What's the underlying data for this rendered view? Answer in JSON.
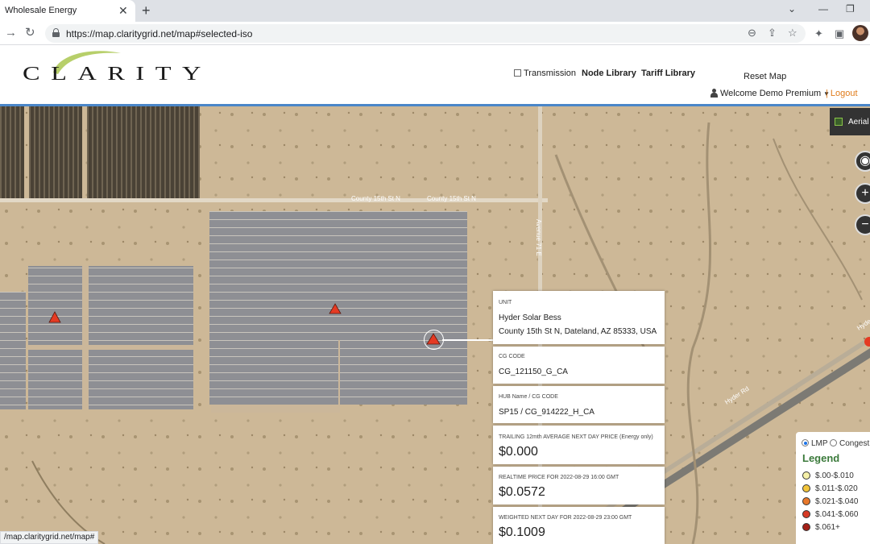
{
  "browser": {
    "tab_title": "Wholesale Energy",
    "tab_close": "✕",
    "new_tab": "+",
    "url": "https://map.claritygrid.net/map#selected-iso",
    "status_url": "/map.claritygrid.net/map#",
    "icons": [
      "back-icon",
      "reload-icon",
      "lock-icon",
      "zoom-icon",
      "share-icon",
      "star-icon",
      "extensions-icon",
      "sidepanel-icon",
      "profile-avatar"
    ]
  },
  "header": {
    "logo_text": "CLARITY",
    "transmission_label": "Transmission",
    "node_library": "Node Library",
    "tariff_library": "Tariff Library",
    "reset_map": "Reset Map",
    "welcome": "Welcome Demo Premium",
    "logout": "Logout"
  },
  "map": {
    "aerial_label": "Aerial",
    "road_labels": [
      "County 15th St N",
      "County 15th St N",
      "Avenue 71 E",
      "Hyder Rd",
      "Hyde"
    ]
  },
  "panel": {
    "unit_label": "UNIT",
    "unit_name": "Hyder Solar Bess",
    "unit_address": "County 15th St N, Dateland, AZ 85333, USA",
    "cg_code_label": "CG CODE",
    "cg_code": "CG_121150_G_CA",
    "hub_label": "HUB Name / CG CODE",
    "hub_value": "SP15 / CG_914222_H_CA",
    "trailing_label": "TRAILING 12mth AVERAGE NEXT DAY PRICE (Energy only)",
    "trailing_value": "$0.000",
    "realtime_label": "REALTIME PRICE FOR 2022-08-29 16:00 GMT",
    "realtime_value": "$0.0572",
    "weighted_label": "WEIGHTED NEXT DAY FOR 2022-08-29 23:00 GMT",
    "weighted_value": "$0.1009"
  },
  "legend": {
    "lmp_label": "LMP",
    "congestion_label": "Congest",
    "title": "Legend",
    "items": [
      {
        "label": "$.00-$.010",
        "color": "#f5f0a8"
      },
      {
        "label": "$.011-$.020",
        "color": "#f2c53a"
      },
      {
        "label": "$.021-$.040",
        "color": "#e8782a"
      },
      {
        "label": "$.041-$.060",
        "color": "#d63a25"
      },
      {
        "label": "$.061+",
        "color": "#a32017"
      }
    ]
  },
  "colors": {
    "accent_rule": "#4a86c8",
    "logout": "#e07b1a",
    "marker": "#e53a23"
  }
}
